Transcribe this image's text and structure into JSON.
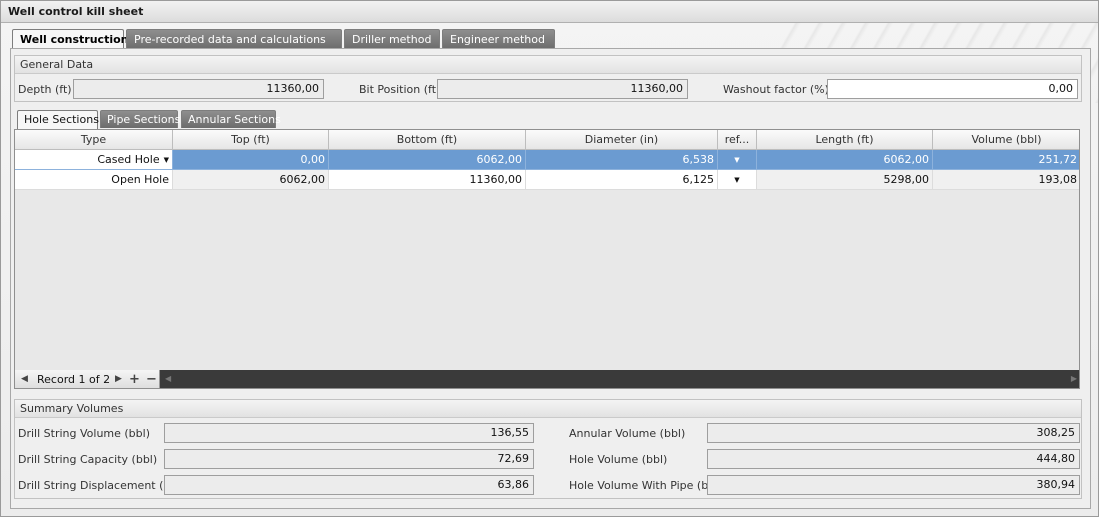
{
  "window": {
    "title": "Well control kill sheet"
  },
  "tabs": [
    {
      "label": "Well construction"
    },
    {
      "label": "Pre-recorded data and calculations"
    },
    {
      "label": "Driller method"
    },
    {
      "label": "Engineer method"
    }
  ],
  "general_data": {
    "header": "General Data",
    "depth_label": "Depth (ft)",
    "depth_value": "11360,00",
    "bit_position_label": "Bit Position (ft)",
    "bit_position_value": "11360,00",
    "washout_label": "Washout factor (%)",
    "washout_value": "0,00"
  },
  "subtabs": [
    {
      "label": "Hole Sections"
    },
    {
      "label": "Pipe Sections"
    },
    {
      "label": "Annular Sections"
    }
  ],
  "grid": {
    "columns": [
      "Type",
      "Top (ft)",
      "Bottom (ft)",
      "Diameter (in)",
      "ref...",
      "Length (ft)",
      "Volume (bbl)"
    ],
    "rows": [
      {
        "type": "Cased Hole",
        "top": "0,00",
        "bottom": "6062,00",
        "diameter": "6,538",
        "length": "6062,00",
        "volume": "251,72"
      },
      {
        "type": "Open Hole",
        "top": "6062,00",
        "bottom": "11360,00",
        "diameter": "6,125",
        "length": "5298,00",
        "volume": "193,08"
      }
    ],
    "record_text": "Record 1 of 2"
  },
  "summary": {
    "header": "Summary Volumes",
    "drill_string_volume_label": "Drill String Volume (bbl)",
    "drill_string_volume": "136,55",
    "drill_string_capacity_label": "Drill String Capacity (bbl)",
    "drill_string_capacity": "72,69",
    "drill_string_displacement_label": "Drill String Displacement (bbl)",
    "drill_string_displacement": "63,86",
    "annular_volume_label": "Annular Volume (bbl)",
    "annular_volume": "308,25",
    "hole_volume_label": "Hole Volume (bbl)",
    "hole_volume": "444,80",
    "hole_volume_with_pipe_label": "Hole Volume With Pipe (bbl)",
    "hole_volume_with_pipe": "380,94"
  }
}
